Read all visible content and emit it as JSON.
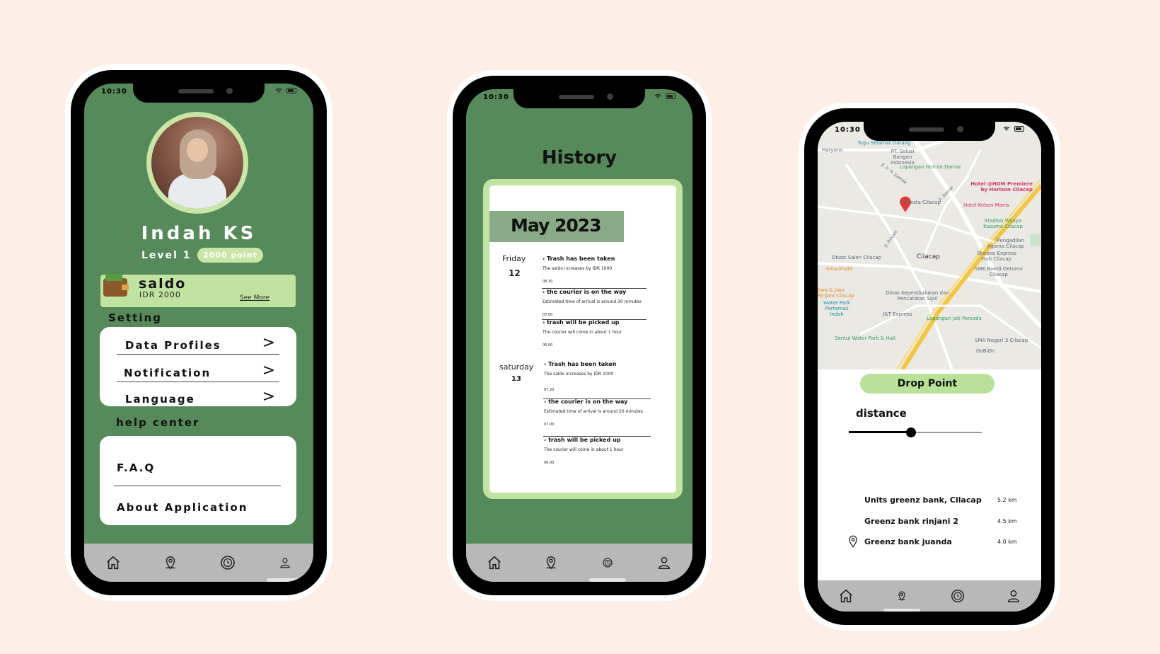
{
  "status": {
    "time": "10:30"
  },
  "profile_screen": {
    "name": "Indah KS",
    "level": "Level 1",
    "points": "2000 point",
    "saldo": {
      "title": "saldo",
      "amount": "IDR 2000",
      "see_more": "See More"
    },
    "setting_label": "Setting",
    "settings": [
      {
        "label": "Data Profiles",
        "arrow": ">"
      },
      {
        "label": "Notification",
        "arrow": ">"
      },
      {
        "label": "Language",
        "arrow": ">"
      }
    ],
    "help_label": "help center",
    "help": [
      {
        "label": "F.A.Q"
      },
      {
        "label": "About Application"
      }
    ]
  },
  "history_screen": {
    "title": "History",
    "month": "May 2023",
    "days": [
      {
        "day": "Friday",
        "date": "12",
        "events": [
          {
            "title": "› Trash has been taken",
            "desc": "The saldo increases by IDR 1000",
            "time": "08.30"
          },
          {
            "title": "› the courier is on the way",
            "desc": "Estimated time of arrival is around 30 minutes",
            "time": "07.00"
          },
          {
            "title": "› trash will be picked up",
            "desc": "The courier will come in about 1 hour",
            "time": "06.00"
          }
        ]
      },
      {
        "day": "saturday",
        "date": "13",
        "events": [
          {
            "title": "› Trash has been taken",
            "desc": "The saldo increases by IDR 1000",
            "time": "07.20"
          },
          {
            "title": "› the courier is on the way",
            "desc": "Estimated time of arrival is around 20 minutes",
            "time": "07.00"
          },
          {
            "title": "› trash will be picked up",
            "desc": "The courier will come in about 1 hour",
            "time": "06.00"
          }
        ]
      }
    ]
  },
  "map_screen": {
    "map_labels": {
      "tugu": "Tugu Selamat Datang",
      "haryono": "Haryono",
      "pt_solusi": "PT. Solusi Bangun Indonesia",
      "juanda_rd": "Jl. Ir. H. Juanda",
      "holcim": "Lapangan Holcim Damar",
      "damar": "Jl. Damar",
      "hotel_hom": "Hotel @HOM Premiere by Horison Cilacap",
      "polresta": "Polresta Cilacap",
      "kebon_manis": "Hotel Kebon Manis",
      "stadion": "Stadion Wijaya Kusuma Cilacap",
      "rinjani_rd": "Jl. Rinjani",
      "pengadilan": "Pengadilan Agama Cilacap",
      "shopee": "Shopee Express Hub Cilacap",
      "dbest": "Dbest Salon Cilacap",
      "cilacap": "Cilacap",
      "seoulmate": "Seoulmate",
      "smk": "SMK Boedi Oetomo Cilacap",
      "jiwa": "Jiwa & Jiwa Rinjani Cilacap",
      "dinas": "Dinas Kependudukan dan Pencatatan Sipil",
      "waterpark": "Water Park Pertamas Indah",
      "jnt": "J&T Express",
      "jati": "Lapangan Jati Persada",
      "sentul": "Sentul Water Park & Hall",
      "sman3": "SMA Negeri 3 Cilacap",
      "gobion": "GoBiOn"
    },
    "drop_point": "Drop Point",
    "distance_label": "distance",
    "distance_value": 0.47,
    "banks": [
      {
        "name": "Units greenz bank, Cilacap",
        "km": "5.2 km"
      },
      {
        "name": "Greenz bank rinjani 2",
        "km": "4.5 km"
      },
      {
        "name": "Greenz bank juanda",
        "km": "4.0 km"
      }
    ]
  },
  "icons": [
    "home-icon",
    "location-icon",
    "history-icon",
    "user-icon"
  ]
}
